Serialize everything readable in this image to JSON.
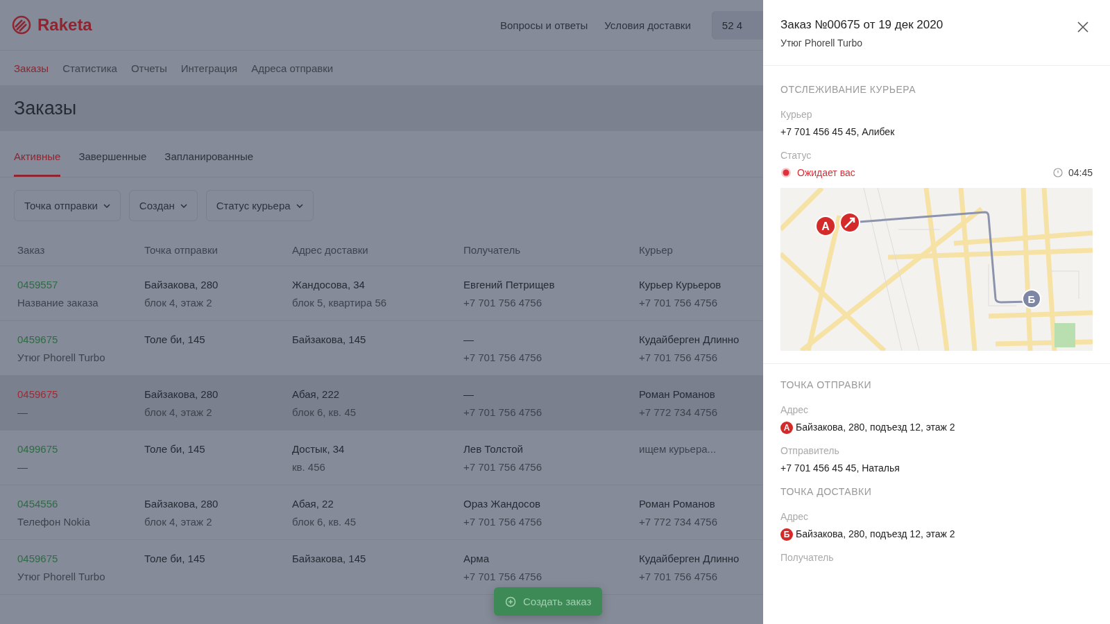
{
  "header": {
    "logo": "Raketa",
    "links": [
      "Вопросы и ответы",
      "Условия доставки"
    ],
    "balance": "52 4"
  },
  "nav": [
    {
      "label": "Заказы",
      "selected": true
    },
    {
      "label": "Статистика",
      "selected": false
    },
    {
      "label": "Отчеты",
      "selected": false
    },
    {
      "label": "Интеграция",
      "selected": false
    },
    {
      "label": "Адреса отправки",
      "selected": false
    }
  ],
  "page_title": "Заказы",
  "tabs": [
    {
      "label": "Активные",
      "selected": true
    },
    {
      "label": "Завершенные",
      "selected": false
    },
    {
      "label": "Запланированные",
      "selected": false
    }
  ],
  "filters": [
    "Точка отправки",
    "Создан",
    "Статус курьера"
  ],
  "table": {
    "columns": [
      "Заказ",
      "Точка отправки",
      "Адрес доставки",
      "Получатель",
      "Курьер"
    ],
    "rows": [
      {
        "selected": false,
        "order": "0459557",
        "name": "Название заказа",
        "from": "Байзакова, 280",
        "from_sub": "блок 4, этаж 2",
        "to": "Жандосова, 34",
        "to_sub": "блок 5, квартира 56",
        "recipient": "Евгений Петрищев",
        "recipient_phone": "+7 701 756 4756",
        "courier": "Курьер Курьеров",
        "courier_phone": "+7 701 756 4756",
        "courier_pending": false
      },
      {
        "selected": false,
        "order": "0459675",
        "name": "Утюг Phorell Turbo",
        "from": "Толе би, 145",
        "from_sub": "",
        "to": "Байзакова, 145",
        "to_sub": "",
        "recipient": "—",
        "recipient_phone": "+7 701 756 4756",
        "courier": "Кудайберген Длинно",
        "courier_phone": "+7 701 756 4756",
        "courier_pending": false
      },
      {
        "selected": true,
        "order": "0459675",
        "name": "—",
        "from": "Байзакова, 280",
        "from_sub": "блок 4, этаж 2",
        "to": "Абая, 222",
        "to_sub": "блок 6, кв. 45",
        "recipient": "—",
        "recipient_phone": "+7 701 756 4756",
        "courier": "Роман Романов",
        "courier_phone": "+7 772 734 4756",
        "courier_pending": false
      },
      {
        "selected": false,
        "order": "0499675",
        "name": "—",
        "from": "Толе би, 145",
        "from_sub": "",
        "to": "Достык, 34",
        "to_sub": "кв. 456",
        "recipient": "Лев Толстой",
        "recipient_phone": "+7 701 756 4756",
        "courier": "ищем курьера...",
        "courier_phone": "",
        "courier_pending": true
      },
      {
        "selected": false,
        "order": "0454556",
        "name": "Телефон Nokia",
        "from": "Байзакова, 280",
        "from_sub": "блок 4, этаж 2",
        "to": "Абая, 22",
        "to_sub": "блок 6, кв. 45",
        "recipient": "Ораз Жандосов",
        "recipient_phone": "+7 701 756 4756",
        "courier": "Роман Романов",
        "courier_phone": "+7 772 734 4756",
        "courier_pending": false
      },
      {
        "selected": false,
        "order": "0459675",
        "name": "Утюг Phorell Turbo",
        "from": "Толе би, 145",
        "from_sub": "",
        "to": "Байзакова, 145",
        "to_sub": "",
        "recipient": "Арма",
        "recipient_phone": "+7 701 756 4756",
        "courier": "Кудайберген Длинно",
        "courier_phone": "+7 701 756 4756",
        "courier_pending": false
      }
    ]
  },
  "create_button": "Создать заказ",
  "drawer": {
    "title": "Заказ №00675 от 19 дек 2020",
    "subtitle": "Утюг Phorell Turbo",
    "tracking": {
      "heading": "ОТСЛЕЖИВАНИЕ КУРЬЕРА",
      "courier_label": "Курьер",
      "courier": "+7 701 456 45 45, Алибек",
      "status_label": "Статус",
      "status": "Ожидает вас",
      "time": "04:45",
      "map": {
        "start_marker": "А",
        "end_marker": "Б"
      }
    },
    "origin": {
      "heading": "ТОЧКА ОТПРАВКИ",
      "address_label": "Адрес",
      "marker": "А",
      "address": "Байзакова, 280, подъезд 12, этаж 2",
      "sender_label": "Отправитель",
      "sender": "+7 701 456 45 45, Наталья"
    },
    "destination": {
      "heading": "ТОЧКА ДОСТАВКИ",
      "address_label": "Адрес",
      "marker": "Б",
      "address": "Байзакова, 280, подъезд 12, этаж 2",
      "recipient_label": "Получатель"
    }
  }
}
